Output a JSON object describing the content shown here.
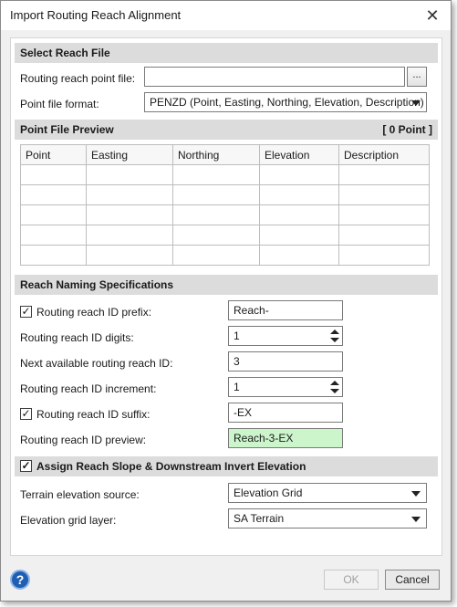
{
  "window": {
    "title": "Import Routing Reach Alignment"
  },
  "select_reach_file": {
    "header": "Select Reach File",
    "point_file_label": "Routing reach point file:",
    "point_file_value": "",
    "browse_label": "...",
    "format_label": "Point file format:",
    "format_value": "PENZD (Point, Easting, Northing, Elevation, Description)"
  },
  "preview": {
    "header": "Point File Preview",
    "count": "[ 0 Point ]",
    "columns": [
      "Point",
      "Easting",
      "Northing",
      "Elevation",
      "Description"
    ]
  },
  "naming": {
    "header": "Reach Naming Specifications",
    "prefix_label": "Routing reach ID prefix:",
    "prefix_checked": true,
    "prefix_value": "Reach-",
    "digits_label": "Routing reach ID digits:",
    "digits_value": "1",
    "next_label": "Next available routing reach ID:",
    "next_value": "3",
    "increment_label": "Routing reach ID increment:",
    "increment_value": "1",
    "suffix_label": "Routing reach ID suffix:",
    "suffix_checked": true,
    "suffix_value": "-EX",
    "preview_label": "Routing reach ID preview:",
    "preview_value": "Reach-3-EX"
  },
  "slope": {
    "header": "Assign Reach Slope & Downstream Invert Elevation",
    "checked": true,
    "terrain_label": "Terrain elevation source:",
    "terrain_value": "Elevation Grid",
    "grid_label": "Elevation grid layer:",
    "grid_value": "SA Terrain"
  },
  "footer": {
    "ok_label": "OK",
    "cancel_label": "Cancel"
  },
  "colors": {
    "preview_bg": "#ccf5cc",
    "help_icon": "#1f5fb3"
  }
}
